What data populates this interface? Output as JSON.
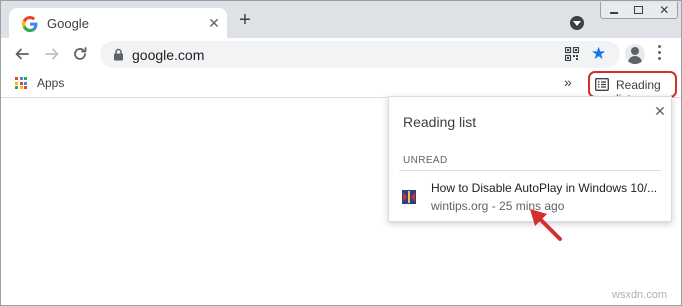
{
  "tab": {
    "title": "Google",
    "close_glyph": "✕",
    "favicon": "google-g-icon"
  },
  "new_tab_glyph": "+",
  "window_controls": {
    "close_glyph": "✕"
  },
  "toolbar": {
    "url": "google.com",
    "bookmark_star": "★"
  },
  "bookmarks_bar": {
    "apps_label": "Apps",
    "overflow_glyph": "»",
    "reading_list_label": "Reading list"
  },
  "reading_list_panel": {
    "title": "Reading list",
    "close_glyph": "✕",
    "section_label": "UNREAD",
    "items": [
      {
        "title": "How to Disable AutoPlay in Windows 10/...",
        "meta": "wintips.org - 25 mins ago"
      }
    ]
  },
  "watermark": "wsxdn.com",
  "colors": {
    "accent_blue": "#1a73e8",
    "highlight_red": "#d32f2f",
    "tab_strip": "#dee1e6"
  }
}
